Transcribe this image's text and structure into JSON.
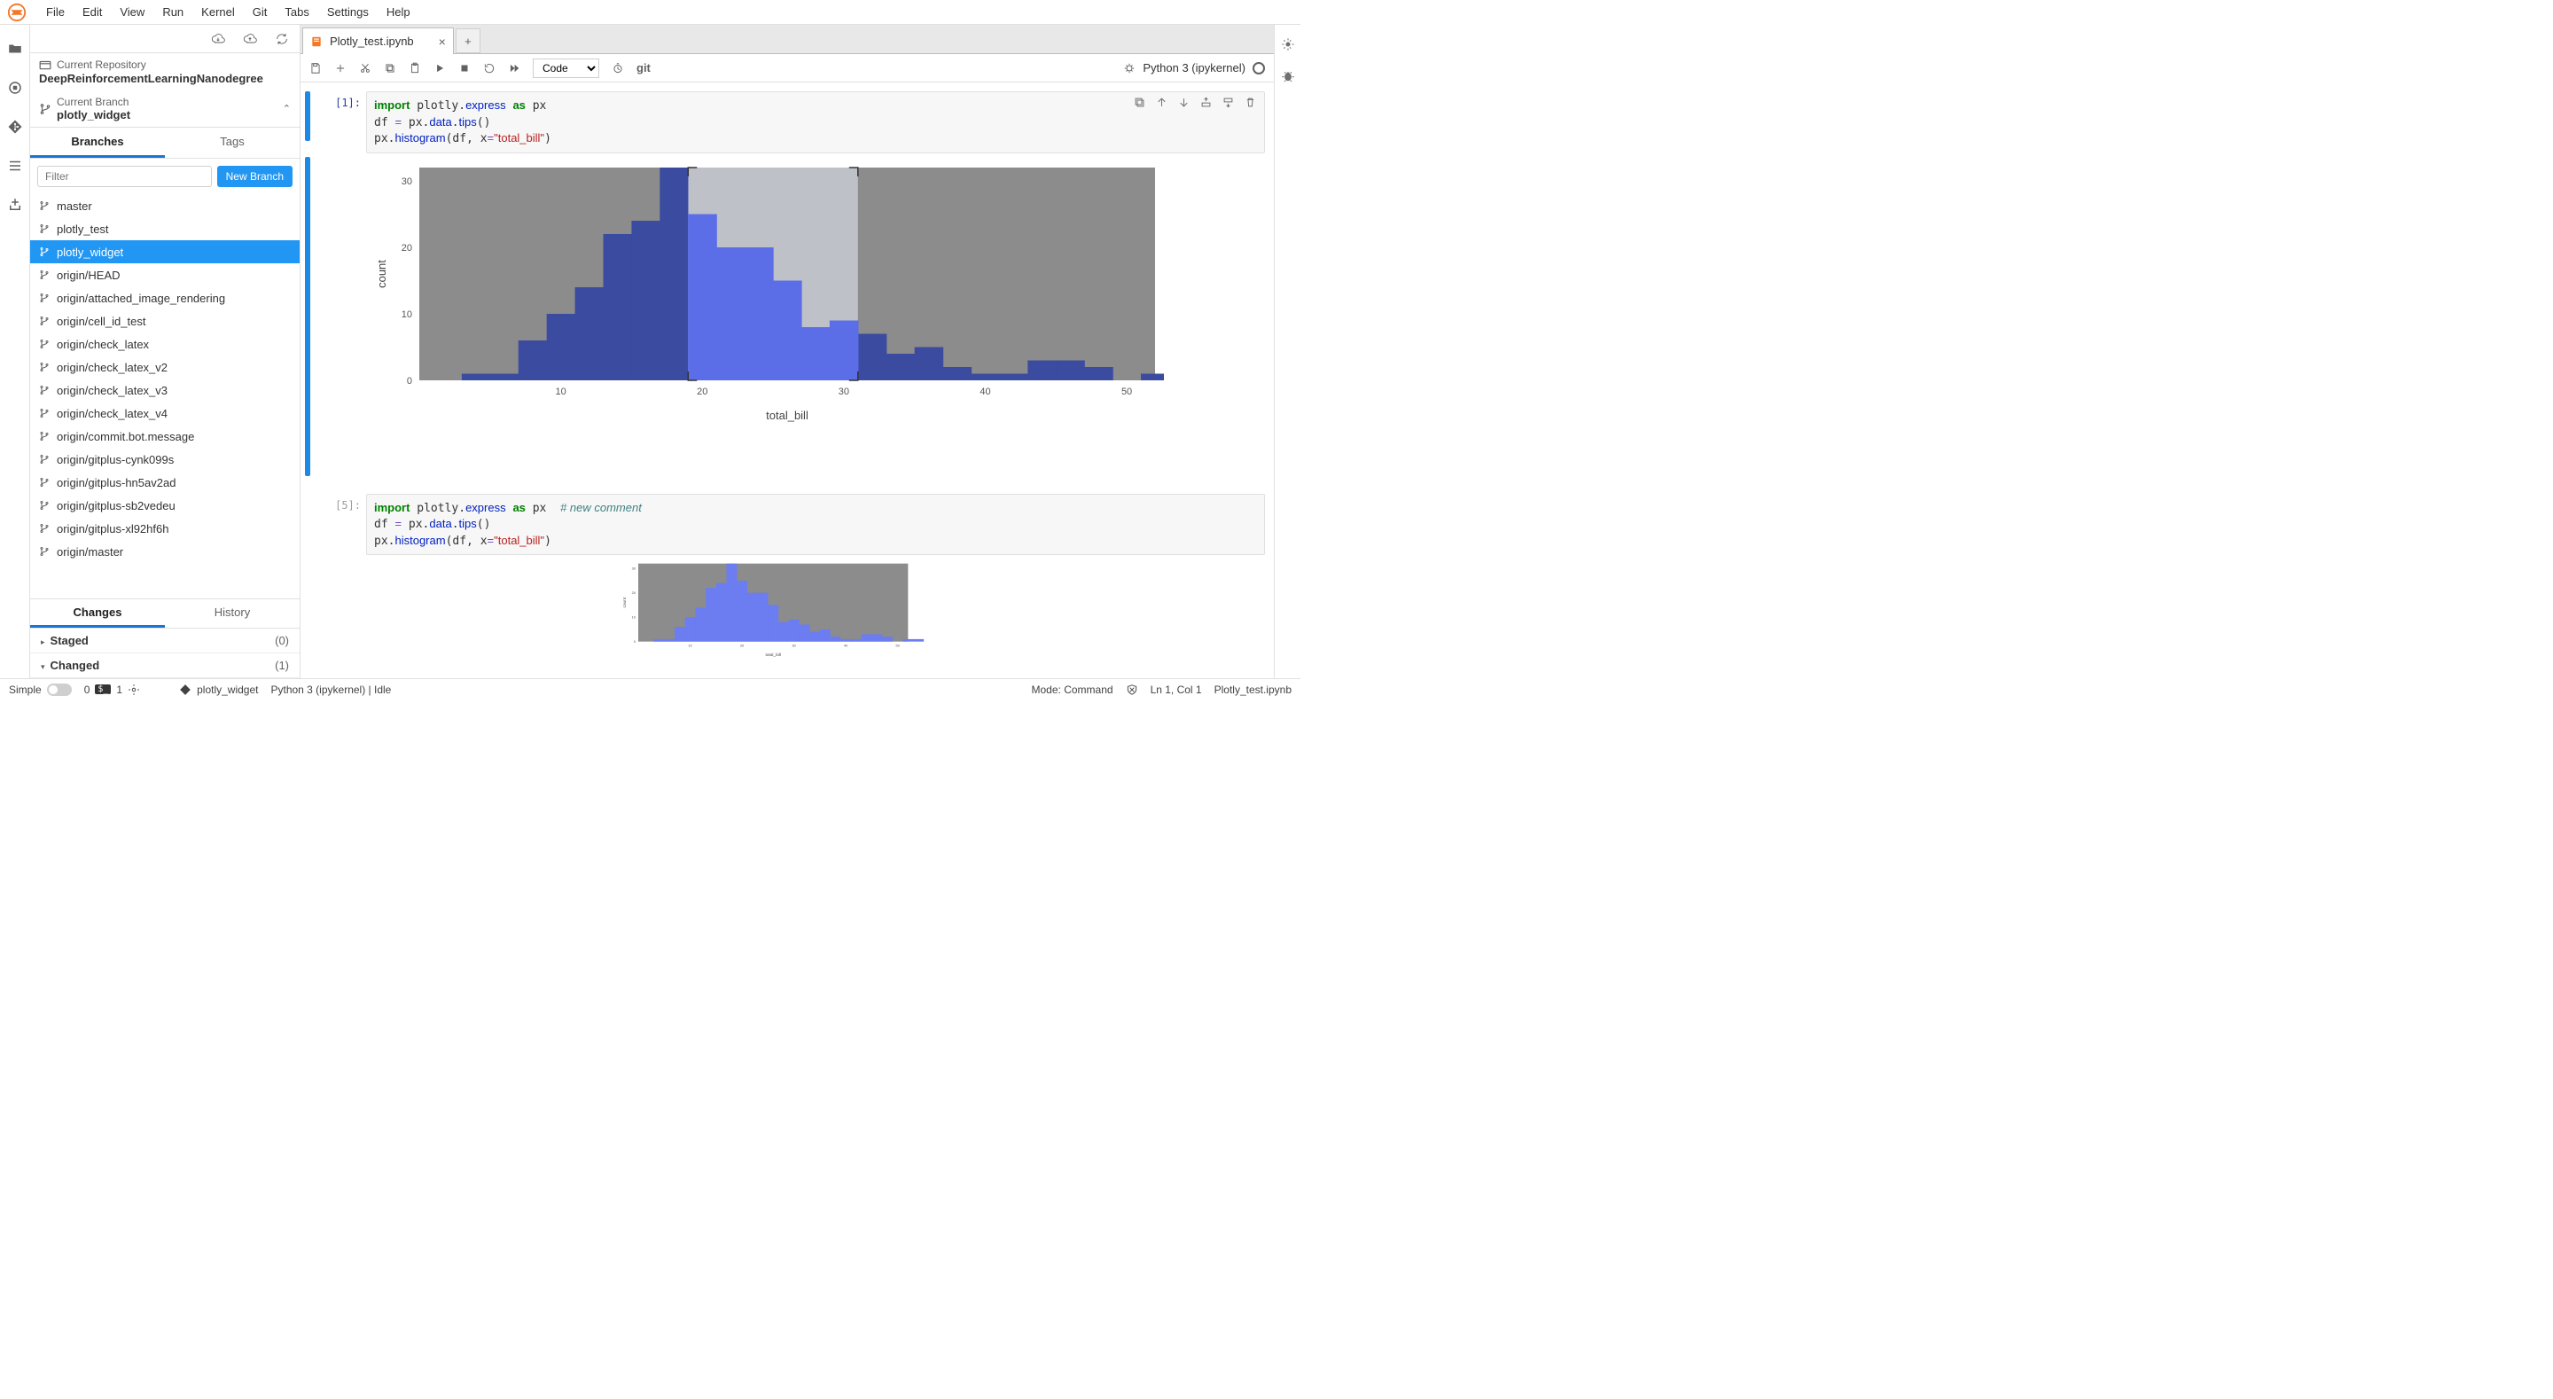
{
  "menu": [
    "File",
    "Edit",
    "View",
    "Run",
    "Kernel",
    "Git",
    "Tabs",
    "Settings",
    "Help"
  ],
  "sidepanel": {
    "repo_label": "Current Repository",
    "repo_name": "DeepReinforcementLearningNanodegree",
    "branch_label": "Current Branch",
    "branch_name": "plotly_widget",
    "tabs": [
      "Branches",
      "Tags"
    ],
    "filter_placeholder": "Filter",
    "new_branch": "New Branch",
    "branches": [
      "master",
      "plotly_test",
      "plotly_widget",
      "origin/HEAD",
      "origin/attached_image_rendering",
      "origin/cell_id_test",
      "origin/check_latex",
      "origin/check_latex_v2",
      "origin/check_latex_v3",
      "origin/check_latex_v4",
      "origin/commit.bot.message",
      "origin/gitplus-cynk099s",
      "origin/gitplus-hn5av2ad",
      "origin/gitplus-sb2vedeu",
      "origin/gitplus-xl92hf6h",
      "origin/master"
    ],
    "selected_branch_index": 2,
    "bottom_tabs": [
      "Changes",
      "History"
    ],
    "sections": [
      {
        "label": "Staged",
        "count": "(0)",
        "arrow": "▸"
      },
      {
        "label": "Changed",
        "count": "(1)",
        "arrow": "▾"
      }
    ]
  },
  "editor": {
    "tab_name": "Plotly_test.ipynb",
    "cell_type": "Code",
    "git_label": "git",
    "kernel_name": "Python 3 (ipykernel)"
  },
  "cells": [
    {
      "prompt": "[1]:"
    },
    {
      "prompt": "[5]:"
    }
  ],
  "chart_data": {
    "type": "bar",
    "xlabel": "total_bill",
    "ylabel": "count",
    "ylim": [
      0,
      32
    ],
    "x_ticks": [
      10,
      20,
      30,
      40,
      50
    ],
    "y_ticks": [
      10,
      20,
      30
    ],
    "bin_start": 3,
    "bin_width": 2,
    "values": [
      1,
      1,
      6,
      10,
      14,
      22,
      24,
      32,
      25,
      20,
      20,
      15,
      8,
      9,
      7,
      4,
      5,
      2,
      1,
      1,
      3,
      3,
      2,
      0,
      1,
      1
    ],
    "selection": {
      "from_bin": 8,
      "to_bin": 13
    },
    "series": [
      {
        "name": "total_bill"
      }
    ]
  },
  "statusbar": {
    "simple": "Simple",
    "zero": "0",
    "one": "1",
    "branch": "plotly_widget",
    "kernel": "Python 3 (ipykernel) | Idle",
    "mode": "Mode: Command",
    "cursor": "Ln 1, Col 1",
    "file": "Plotly_test.ipynb"
  }
}
